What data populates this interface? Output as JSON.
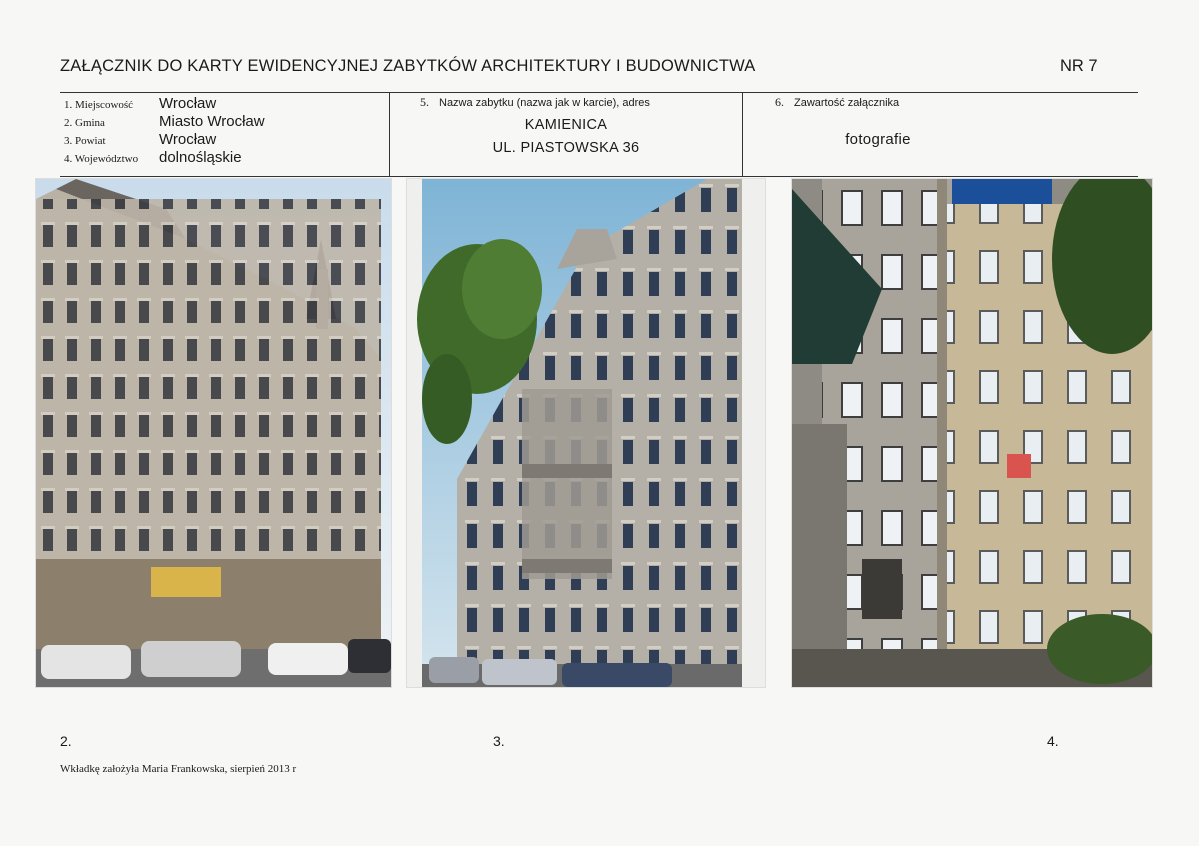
{
  "header": {
    "title": "ZAŁĄCZNIK DO KARTY EWIDENCYJNEJ ZABYTKÓW ARCHITEKTURY I BUDOWNICTWA",
    "nr": "NR 7"
  },
  "fields": {
    "miejscowosc": {
      "label": "1. Miejscowość",
      "value": "Wrocław"
    },
    "gmina": {
      "label": "2. Gmina",
      "value": "Miasto Wrocław"
    },
    "powiat": {
      "label": "3. Powiat",
      "value": "Wrocław"
    },
    "wojewodztwo": {
      "label": "4. Województwo",
      "value": "dolnośląskie"
    }
  },
  "monument": {
    "number": "5.",
    "label": "Nazwa zabytku (nazwa jak w karcie), adres",
    "name": "KAMIENICA",
    "address": "UL. PIASTOWSKA 36"
  },
  "contents": {
    "number": "6.",
    "label": "Zawartość załącznika",
    "value": "fotografie"
  },
  "photos": [
    {
      "caption": "2."
    },
    {
      "caption": "3."
    },
    {
      "caption": "4."
    }
  ],
  "footer": "Wkładkę założyła Maria Frankowska, sierpień 2013 r"
}
